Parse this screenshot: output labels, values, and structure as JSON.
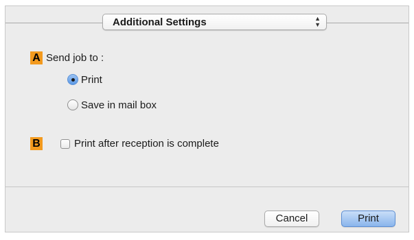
{
  "popup": {
    "label": "Additional Settings"
  },
  "send_job": {
    "badge": "A",
    "label": "Send job to :",
    "options": [
      {
        "label": "Print",
        "selected": true
      },
      {
        "label": "Save in mail box",
        "selected": false
      }
    ]
  },
  "print_after": {
    "badge": "B",
    "label": "Print after reception is complete",
    "checked": false
  },
  "buttons": {
    "cancel": "Cancel",
    "print": "Print"
  },
  "colors": {
    "badge": "#f39a1e",
    "accent": "#5b98e6"
  }
}
